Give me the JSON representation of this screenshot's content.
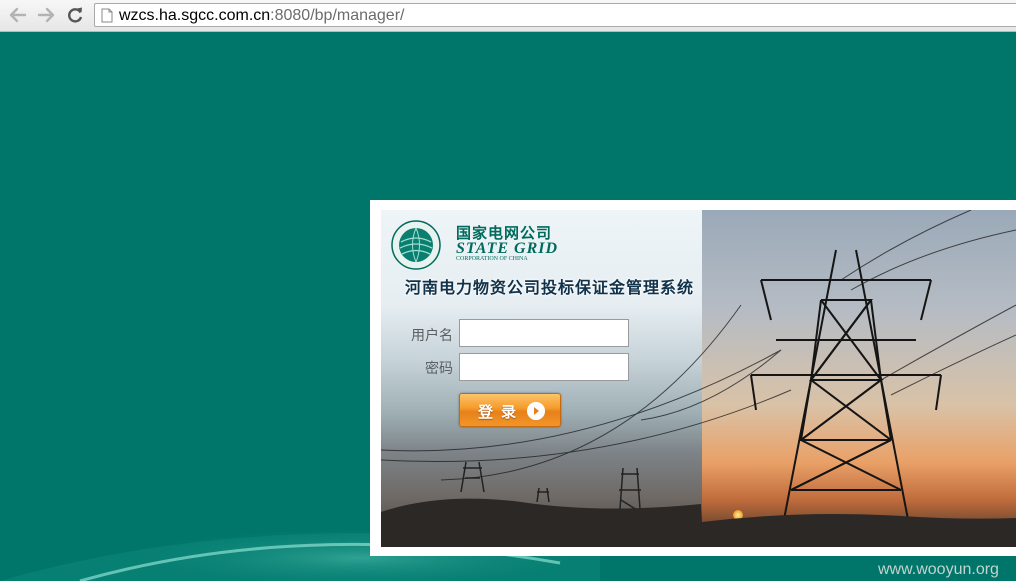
{
  "browser": {
    "url_host": "wzcs.ha.sgcc.com.cn",
    "url_rest": ":8080/bp/manager/",
    "icons": {
      "back": "arrow-left-icon",
      "forward": "arrow-right-icon",
      "reload": "reload-icon",
      "page": "page-icon"
    }
  },
  "logo": {
    "name_cn": "国家电网公司",
    "name_en": "STATE GRID",
    "sub_en": "CORPORATION OF CHINA"
  },
  "system_title": "河南电力物资公司投标保证金管理系统",
  "form": {
    "username_label": "用户名",
    "username_value": "",
    "password_label": "密码",
    "password_value": "",
    "login_label": "登录"
  },
  "watermark": "www.wooyun.org",
  "colors": {
    "background": "#00766a",
    "brand_green": "#006b5c",
    "button_orange": "#f59a2a"
  }
}
